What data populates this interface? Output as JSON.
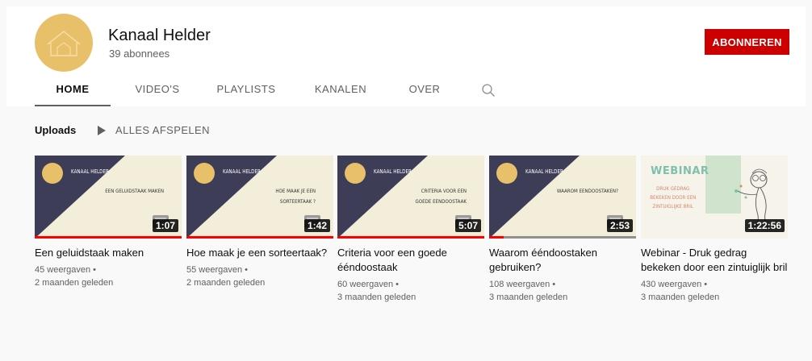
{
  "channel": {
    "name": "Kanaal Helder",
    "subscribers": "39 abonnees",
    "subscribe_label": "ABONNEREN",
    "accent_color": "#cc0000",
    "avatar_color": "#e9c06a"
  },
  "tabs": [
    {
      "label": "HOME",
      "active": true
    },
    {
      "label": "VIDEO'S",
      "active": false
    },
    {
      "label": "PLAYLISTS",
      "active": false
    },
    {
      "label": "KANALEN",
      "active": false
    },
    {
      "label": "OVER",
      "active": false
    }
  ],
  "tab_search_icon": "search-icon",
  "section": {
    "title": "Uploads",
    "play_all_label": "ALLES AFSPELEN",
    "play_icon": "play-icon"
  },
  "videos": [
    {
      "title": "Een geluidstaak maken",
      "views": "45 weergaven •",
      "age": "2 maanden geleden",
      "duration": "1:07",
      "watched_fraction": 1.0,
      "thumb_brand": "KANAAL HELDER",
      "thumb_title": "EEN GELUIDSTAAK MAKEN"
    },
    {
      "title": "Hoe maak je een sorteertaak?",
      "views": "55 weergaven •",
      "age": "2 maanden geleden",
      "duration": "1:42",
      "watched_fraction": 1.0,
      "thumb_brand": "KANAAL HELDER",
      "thumb_title": "HOE MAAK JE EEN SORTEERTAAK ?"
    },
    {
      "title": "Criteria voor een goede ééndoostaak",
      "views": "60 weergaven •",
      "age": "3 maanden geleden",
      "duration": "5:07",
      "watched_fraction": 1.0,
      "thumb_brand": "KANAAL HELDER",
      "thumb_title": "CRITERIA VOOR EEN GOEDE EENDOOSTAAK"
    },
    {
      "title": "Waarom ééndoostaken gebruiken?",
      "views": "108 weergaven •",
      "age": "3 maanden geleden",
      "duration": "2:53",
      "watched_fraction": 0.1,
      "thumb_brand": "KANAAL HELDER",
      "thumb_title": "WAAROM EENDOOSTAKEN?"
    },
    {
      "title": "Webinar - Druk gedrag bekeken door een zintuiglijk bril",
      "views": "430 weergaven •",
      "age": "3 maanden geleden",
      "duration": "1:22:56",
      "watched_fraction": 0,
      "thumb_brand": "WEBINAR",
      "thumb_title": "DRUK GEDRAG BEKEKEN DOOR EEN ZINTUIGLIJKE BRIL"
    }
  ]
}
